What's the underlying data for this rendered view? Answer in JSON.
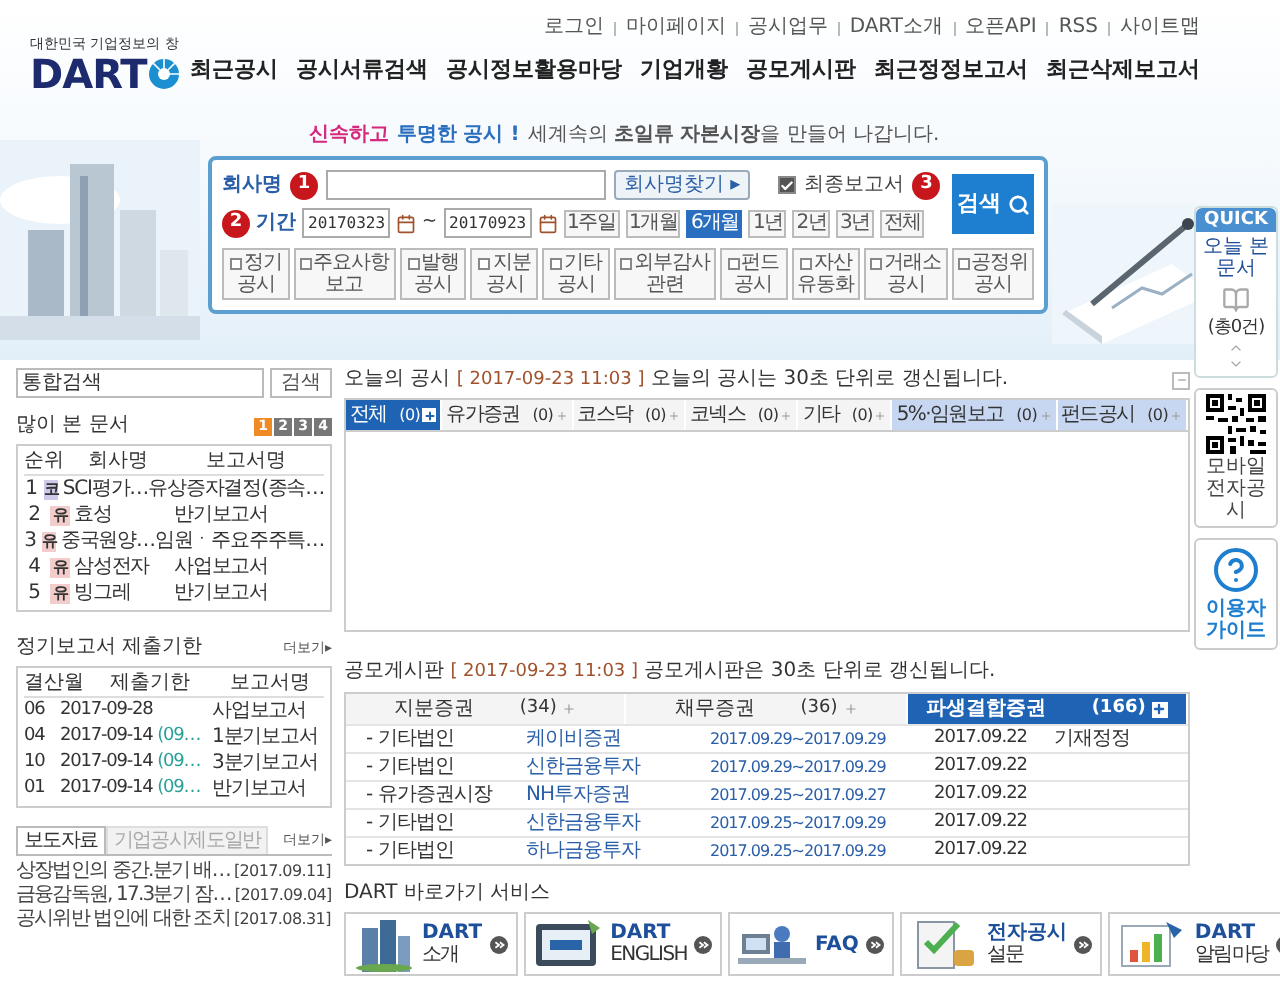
{
  "header": {
    "logo": {
      "tagline": "대한민국 기업정보의 창",
      "name": "DART"
    },
    "top_links": [
      "로그인",
      "마이페이지",
      "공시업무",
      "DART소개",
      "오픈API",
      "RSS",
      "사이트맵"
    ],
    "nav": [
      "최근공시",
      "공시서류검색",
      "공시정보활용마당",
      "기업개황",
      "공모게시판",
      "최근정정보고서",
      "최근삭제보고서"
    ]
  },
  "hero": {
    "tagline": [
      {
        "text": "신속하고",
        "kind": "pink"
      },
      {
        "text": "투명한 공시 !",
        "kind": "blue"
      },
      {
        "text": "세계속의 **초일류** **자본시장**을 만들어 나갑니다.",
        "kind": "plain"
      }
    ]
  },
  "search": {
    "step_badges": [
      "1",
      "2",
      "3"
    ],
    "company_label": "회사명",
    "find_button": "회사명찾기 ▸",
    "final_report": {
      "label": "최종보고서",
      "checked": true
    },
    "period_label": "기간",
    "date_from": "20170323",
    "date_sep": "~",
    "date_to": "20170923",
    "periods": [
      {
        "label": "1주일",
        "selected": false
      },
      {
        "label": "1개월",
        "selected": false
      },
      {
        "label": "6개월",
        "selected": true
      },
      {
        "label": "1년",
        "selected": false
      },
      {
        "label": "2년",
        "selected": false
      },
      {
        "label": "3년",
        "selected": false
      },
      {
        "label": "전체",
        "selected": false
      }
    ],
    "search_button": "검색",
    "types": [
      {
        "lines": [
          "정기",
          "공시"
        ],
        "checked": false
      },
      {
        "lines": [
          "주요사항",
          "보고"
        ],
        "checked": false
      },
      {
        "lines": [
          "발행",
          "공시"
        ],
        "checked": false
      },
      {
        "lines": [
          "지분",
          "공시"
        ],
        "checked": false
      },
      {
        "lines": [
          "기타",
          "공시"
        ],
        "checked": false
      },
      {
        "lines": [
          "외부감사",
          "관련"
        ],
        "checked": false
      },
      {
        "lines": [
          "펀드",
          "공시"
        ],
        "checked": false
      },
      {
        "lines": [
          "자산",
          "유동화"
        ],
        "checked": false
      },
      {
        "lines": [
          "거래소",
          "공시"
        ],
        "checked": false
      },
      {
        "lines": [
          "공정위",
          "공시"
        ],
        "checked": false
      }
    ]
  },
  "left": {
    "search": {
      "value": "통합검색",
      "button": "검색"
    },
    "popular": {
      "title": "많이 본 문서",
      "pages": [
        {
          "label": "1",
          "selected": true
        },
        {
          "label": "2",
          "selected": false
        },
        {
          "label": "3",
          "selected": false
        },
        {
          "label": "4",
          "selected": false
        }
      ],
      "columns": [
        "순위",
        "회사명",
        "보고서명"
      ],
      "rows": [
        {
          "rank": "1",
          "market": "코",
          "color": "#cfc9ec",
          "company": "SCI평가…",
          "report": "유상증자결정(종속…"
        },
        {
          "rank": "2",
          "market": "유",
          "color": "#f3cccc",
          "company": "효성",
          "report": "반기보고서"
        },
        {
          "rank": "3",
          "market": "유",
          "color": "#f3cccc",
          "company": "중국원양…",
          "report": "임원ㆍ주요주주특…"
        },
        {
          "rank": "4",
          "market": "유",
          "color": "#f3cccc",
          "company": "삼성전자",
          "report": "사업보고서"
        },
        {
          "rank": "5",
          "market": "유",
          "color": "#f3cccc",
          "company": "빙그레",
          "report": "반기보고서"
        }
      ]
    },
    "deadlines": {
      "title": "정기보고서 제출기한",
      "more": "더보기▸",
      "columns": [
        "결산월",
        "제출기한",
        "보고서명"
      ],
      "rows": [
        {
          "month": "06",
          "deadline": "2017-09-28",
          "report": "사업보고서"
        },
        {
          "month": "04",
          "deadline": "2017-09-14",
          "extra": "(09…",
          "report": "1분기보고서"
        },
        {
          "month": "10",
          "deadline": "2017-09-14",
          "extra": "(09…",
          "report": "3분기보고서"
        },
        {
          "month": "01",
          "deadline": "2017-09-14",
          "extra": "(09…",
          "report": "반기보고서"
        }
      ]
    },
    "news": {
      "tabs": [
        {
          "label": "보도자료",
          "selected": true
        },
        {
          "label": "기업공시제도일반",
          "selected": false
        }
      ],
      "more": "더보기▸",
      "items": [
        {
          "title": "상장법인의 중간.분기 배…",
          "date": "[2017.09.11]"
        },
        {
          "title": "금융감독원, 17.3분기 잠…",
          "date": "[2017.09.04]"
        },
        {
          "title": "공시위반 법인에 대한 조치",
          "date": "[2017.08.31]"
        }
      ]
    }
  },
  "today": {
    "title": "오늘의 공시",
    "timestamp": "[ 2017-09-23 11:03 ]",
    "note": "오늘의 공시는 30초 단위로 갱신됩니다.",
    "tabs": [
      {
        "label": "전체",
        "count": "(0)",
        "kind": "market",
        "selected": true
      },
      {
        "label": "유가증권",
        "count": "(0)",
        "kind": "market",
        "selected": false
      },
      {
        "label": "코스닥",
        "count": "(0)",
        "kind": "market",
        "selected": false
      },
      {
        "label": "코넥스",
        "count": "(0)",
        "kind": "market",
        "selected": false
      },
      {
        "label": "기타",
        "count": "(0)",
        "kind": "market",
        "selected": false
      },
      {
        "label": "5%·임원보고",
        "count": "(0)",
        "kind": "report",
        "selected": false
      },
      {
        "label": "펀드공시",
        "count": "(0)",
        "kind": "report",
        "selected": false
      }
    ]
  },
  "offering": {
    "title": "공모게시판",
    "timestamp": "[ 2017-09-23 11:03 ]",
    "note": "공모게시판은 30초 단위로 갱신됩니다.",
    "tabs": [
      {
        "label": "지분증권",
        "count": "(34)",
        "selected": false
      },
      {
        "label": "채무증권",
        "count": "(36)",
        "selected": false
      },
      {
        "label": "파생결합증권",
        "count": "(166)",
        "selected": true
      }
    ],
    "rows": [
      {
        "market": "- 기타법인",
        "company": "케이비증권",
        "period": "2017.09.29~2017.09.29",
        "date": "2017.09.22",
        "note": "기재정정"
      },
      {
        "market": "- 기타법인",
        "company": "신한금융투자",
        "period": "2017.09.29~2017.09.29",
        "date": "2017.09.22"
      },
      {
        "market": "- 유가증권시장",
        "company": "NH투자증권",
        "period": "2017.09.25~2017.09.27",
        "date": "2017.09.22"
      },
      {
        "market": "- 기타법인",
        "company": "신한금융투자",
        "period": "2017.09.25~2017.09.29",
        "date": "2017.09.22"
      },
      {
        "market": "- 기타법인",
        "company": "하나금융투자",
        "period": "2017.09.25~2017.09.29",
        "date": "2017.09.22"
      }
    ]
  },
  "shortcuts": {
    "title": "DART 바로가기 서비스",
    "items": [
      {
        "kind": "intro",
        "title": "DART",
        "subtitle": "소개"
      },
      {
        "kind": "english",
        "title": "DART",
        "subtitle": "ENGLISH"
      },
      {
        "kind": "faq",
        "title": "FAQ"
      },
      {
        "kind": "survey",
        "title": "전자공시",
        "subtitle": "설문"
      },
      {
        "kind": "notice",
        "title": "DART",
        "subtitle": "알림마당"
      }
    ]
  },
  "quick": {
    "title": "QUICK",
    "recent": "오늘 본 문서",
    "count": "(총0건)",
    "qr_label": "모바일전자공시",
    "guide": "이용자가이드"
  }
}
